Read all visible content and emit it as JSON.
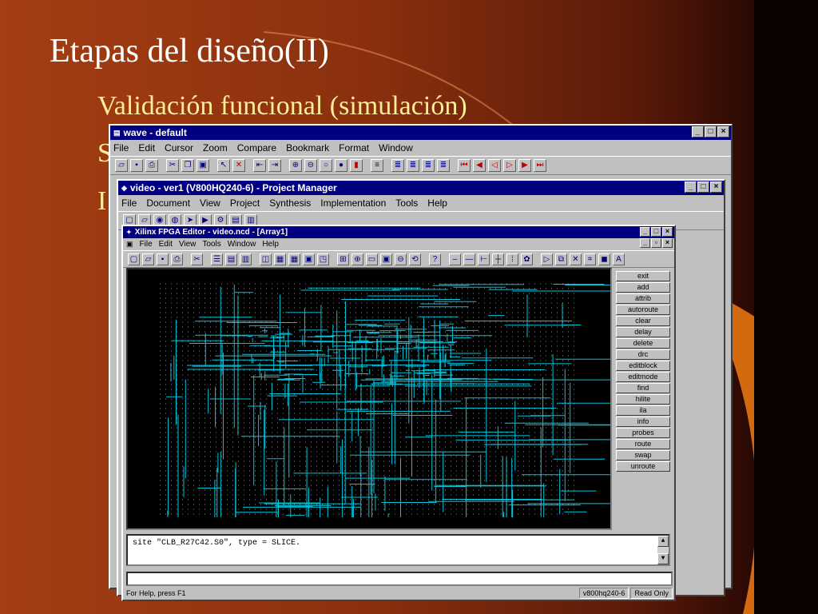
{
  "slide": {
    "title": "Etapas del diseño(II)",
    "bullets": [
      "Validación funcional (simulación)",
      "S",
      "I"
    ]
  },
  "wave": {
    "title": "wave - default",
    "menu": [
      "File",
      "Edit",
      "Cursor",
      "Zoom",
      "Compare",
      "Bookmark",
      "Format",
      "Window"
    ]
  },
  "project_manager": {
    "title": "video - ver1 (V800HQ240-6) - Project Manager",
    "menu": [
      "File",
      "Document",
      "View",
      "Project",
      "Synthesis",
      "Implementation",
      "Tools",
      "Help"
    ]
  },
  "fpga_editor": {
    "title": "Xilinx FPGA Editor - video.ncd - [Array1]",
    "menu": [
      "File",
      "Edit",
      "View",
      "Tools",
      "Window",
      "Help"
    ],
    "commands": [
      "exit",
      "add",
      "attrib",
      "autoroute",
      "clear",
      "delay",
      "delete",
      "drc",
      "editblock",
      "editmode",
      "find",
      "hilite",
      "ila",
      "info",
      "probes",
      "route",
      "swap",
      "unroute"
    ],
    "console_text": "site \"CLB_R27C42.S0\",  type = SLICE.",
    "status_help": "For Help, press F1",
    "status_device": "v800hq240-6",
    "status_mode": "Read Only"
  },
  "colors": {
    "titlebar": "#000080",
    "window": "#c0c0c0",
    "routing": "#00e5ff",
    "bullet_text": "#ffee99"
  }
}
